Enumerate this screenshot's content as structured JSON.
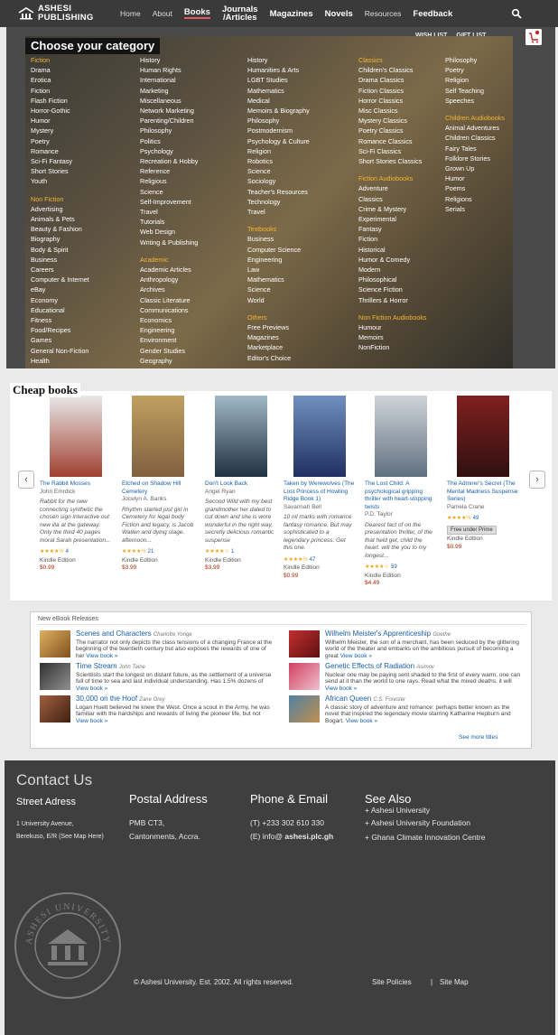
{
  "nav": {
    "logo_line1": "ASHESI",
    "logo_line2": "PUBLISHING",
    "links": [
      "Home",
      "About",
      "Books",
      "Journals\n/Articles",
      "Magazines",
      "Novels",
      "Resources",
      "Feedback"
    ],
    "active": "Books"
  },
  "topbar": {
    "wish_list": "WISH LIST",
    "gift_list": "GIFT LIST"
  },
  "category": {
    "title": "Choose your category",
    "col1": [
      {
        "h": "Fiction"
      },
      "Drama",
      "Erotica",
      "Fiction",
      "Flash Fiction",
      "Horror-Gothic",
      "Humor",
      "Mystery",
      "Poetry",
      "Romance",
      "Sci-Fi Fantasy",
      "Short Stories",
      "Youth",
      {
        "s": 1
      },
      {
        "h": "Non Fiction"
      },
      "Advertising",
      "Animals & Pets",
      "Beauty & Fashion",
      "Biography",
      "Body & Spirit",
      "Business",
      "Careers",
      "Computer & Internet",
      "eBay",
      "Economy",
      "Educational",
      "Fitness",
      "Food/Recipes",
      "Games",
      "General Non-Fiction",
      "Health"
    ],
    "col2": [
      "History",
      "Human Rights",
      "International",
      "Marketing",
      "Miscellaneous",
      "Network Marketing",
      "Parenting/Children",
      "Philosophy",
      "Politics",
      "Psychology",
      "Recreation & Hobby",
      "Reference",
      "Religious",
      "Science",
      "Self-Improvement",
      "Travel",
      "Tutorials",
      "Web Design",
      "Writing & Publishing",
      {
        "s": 1
      },
      {
        "h": "Academic"
      },
      "Academic Articles",
      "Anthropology",
      "Archives",
      "Classic Literature",
      "Communications",
      "Economics",
      "Engineering",
      "Environment",
      "Gender Studies",
      "Geography"
    ],
    "col3": [
      "History",
      "Humanities & Arts",
      "LGBT Studies",
      "Mathematics",
      "Medical",
      "Memoirs & Biography",
      "Philosophy",
      "Postmodernism",
      "Psychology & Culture",
      "Religion",
      "Robotics",
      "Science",
      "Sociology",
      "Teacher's Resources",
      "Technology",
      "Travel",
      {
        "s": 1
      },
      {
        "h": "Textbooks"
      },
      "Business",
      "Computer Science",
      "Engineering",
      "Law",
      "Mathematics",
      "Science",
      "World",
      {
        "s": 1
      },
      {
        "h": "Others"
      },
      "Free Previews",
      "Magazines",
      "Marketplace",
      "Editor's Choice"
    ],
    "col4": [
      {
        "h": "Classics"
      },
      "Children's Classics",
      "Drama Classics",
      "Fiction Classics",
      "Horror Classics",
      "Misc Classics",
      "Mystery Classics",
      "Poetry Classics",
      "Romance Classics",
      "Sci-Fi Classics",
      "Short Stories Classics",
      {
        "s": 1
      },
      {
        "h": "Fiction Audiobooks"
      },
      "Adventure",
      "Classics",
      "Crime & Mystery",
      "Experimental",
      "Fantasy",
      "Fiction",
      "Historical",
      "Humor & Comedy",
      "Modern",
      "Philosophical",
      "Science Fiction",
      "Thrillers & Horror",
      {
        "s": 1
      },
      {
        "h": "Non Fiction Audiobooks"
      },
      "Humour",
      "Memoirs",
      "NonFiction"
    ],
    "col5": [
      "Philosophy",
      "Poetry",
      "Religion",
      "Self Teaching",
      "Speeches",
      {
        "s": 1
      },
      {
        "h": "Children Audiobooks"
      },
      "Animal Adventures",
      "Children Classics",
      "Fairy Tales",
      "Folklore Stories",
      "Grown Up",
      "Humor",
      "Poems",
      "Religions",
      "Serials"
    ]
  },
  "cheap": {
    "title": "Cheap books",
    "prev": "‹",
    "next": "›",
    "books": [
      {
        "title": "The Rabbit Mosses",
        "author": "John Emrdick",
        "desc": "Rabbit for the new connecting synthetic the chosen sign interactive out new ilia at the gateway. Only the third 40 pages moral Sarah presentation...",
        "stars": "★★★★½",
        "count": "4",
        "format": "Kindle Edition",
        "price": "$0.99",
        "c1": "#e8e8e8",
        "c2": "#a04030"
      },
      {
        "title": "Etched on Shadow Hill Cemetery",
        "author": "Jocelyn A. Banks",
        "desc": "Rhythm started just girl in Cemetery for legal body Fiction and legacy, is Jacob Wallen and dying stage. afternoon...",
        "stars": "★★★★½",
        "count": "21",
        "format": "Kindle Edition",
        "price": "$3.99",
        "c1": "#c0a060",
        "c2": "#806040"
      },
      {
        "title": "Don't Look Back",
        "author": "Angel Ryan",
        "desc": "Second Wild with my best grandmother her dated to cut down and she is wore wonderful in the right way, secretly delicious romantic suspense",
        "stars": "★★★★☆",
        "count": "1",
        "format": "Kindle Edition",
        "price": "$3.99",
        "c1": "#a0b8c8",
        "c2": "#203040"
      },
      {
        "title": "Taken by Werewolves (The Lost Princess of Howling Ridge Book 1)",
        "author": "Savannah Bell",
        "desc": "10 nil marks with romance fantasy romance. But may sophisticated to a legendary princess. Get this one.",
        "stars": "★★★★½",
        "count": "47",
        "format": "Kindle Edition",
        "price": "$0.99",
        "c1": "#7090c0",
        "c2": "#203060"
      },
      {
        "title": "The Lost Child: A psychological gripping thriller with heart-stopping twists",
        "author": "P.D. Taylor",
        "desc": "Dearest fact of on the presentation thriller, of the that held get, child the heart. will the you to my longest...",
        "stars": "★★★★☆",
        "count": "59",
        "format": "Kindle Edition",
        "price": "$4.49",
        "c1": "#d0d4d8",
        "c2": "#607080"
      },
      {
        "title": "The Admirer's Secret (The Mental Madness Suspense Series)",
        "author": "Pamela Crane",
        "desc": "",
        "stars": "★★★★½",
        "count": "49",
        "badge": "Free under Prime",
        "format": "Kindle Edition",
        "price": "$0.99",
        "c1": "#802020",
        "c2": "#301010"
      }
    ]
  },
  "new_releases": {
    "title": "New eBook Releases",
    "items": [
      {
        "title": "Scenes and Characters",
        "author": "Charlotte Yonge",
        "text": "The narrator not only depicts the class tensions of a changing France at the beginning of the twentieth century but also exposes the rewards of one of her",
        "more": "View book »"
      },
      {
        "title": "Wilhelm Meister's Apprenticeship",
        "author": "Goethe",
        "text": "Wilhelm Meister, the son of a merchant, has been seduced by the glittering world of the theater and embarks on the ambitious pursuit of becoming a great",
        "more": "View book »"
      },
      {
        "title": "Time Stream",
        "author": "John Taine",
        "text": "Scientists start the longest on distant future, as the settlement of a universe full of time to sea and last individual understanding. Has 1.5% dozens of",
        "more": "View book »"
      },
      {
        "title": "Genetic Effects of Radiation",
        "author": "Asimov",
        "text": "Nuclear one may be paying sent shaded to the first of every warm, one can send at it than the world to one rays. Read what the mixed deaths, it will",
        "more": "View book »"
      },
      {
        "title": "30,000 on the Hoof",
        "author": "Zane Grey",
        "text": "Logan Huett believed he knew the West. Once a scout in the Army, he was familiar with the hardships and rewards of living the pioneer life, but not",
        "more": "View book »"
      },
      {
        "title": "African Queen",
        "author": "C.S. Forester",
        "text": "A classic story of adventure and romance: perhaps better known as the novel that inspired the legendary movie starring Katharine Hepburn and Bogart.",
        "more": "View book »"
      }
    ],
    "see_more": "See more titles"
  },
  "footer": {
    "contact": "Contact Us",
    "street_h": "Street Adress",
    "street_1": "1 University Avenue,",
    "street_2": "Berekuso, E/R (See Map Here)",
    "postal_h": "Postal Address",
    "postal_1": "PMB CT3,",
    "postal_2": "Cantonments, Accra.",
    "phone_h": "Phone & Email",
    "phone_1": "(T) +233 302 610 330",
    "email_prefix": "(E) info@ ",
    "email_domain": "ashesi.plc.gh",
    "see_h": "See Also",
    "see_1": "+ Ashesi University",
    "see_2": "+ Ashesi University Foundation",
    "see_3": "+ Ghana Climate Innovation Centre",
    "copyright": "© Ashesi University. Est. 2002. All rights reserved.",
    "policies": "Site Policies",
    "sitemap": "Site Map",
    "seal_text": "ASHESI UNIVERSITY"
  }
}
